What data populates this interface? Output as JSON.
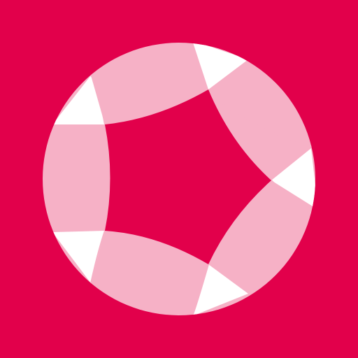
{
  "app_icon": {
    "icon": "pentagon-star-in-circle-logo-icon",
    "colors": {
      "background": "#E2004B",
      "segment": "#F6B1C6",
      "accent": "#FFFFFF"
    }
  }
}
